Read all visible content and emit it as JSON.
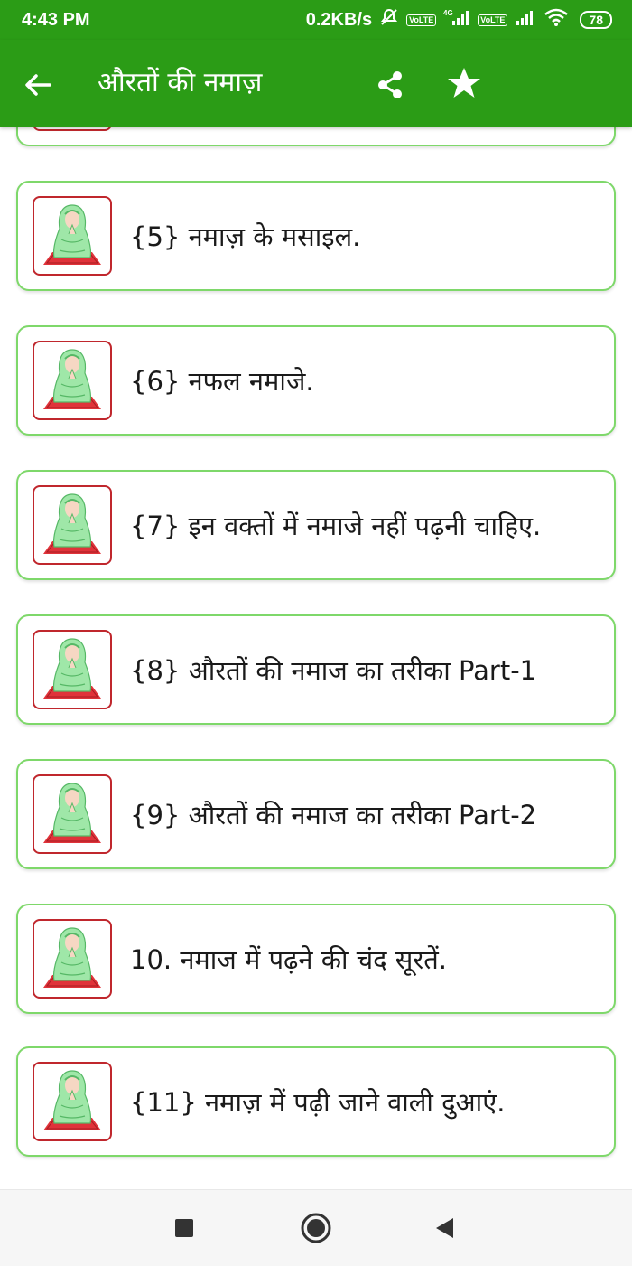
{
  "status_bar": {
    "time": "4:43 PM",
    "net_speed": "0.2KB/s",
    "volte_1": "Vo\nLTE",
    "network_4g": "4G",
    "volte_2": "Vo\nLTE",
    "battery": "78"
  },
  "app_bar": {
    "title": "औरतों की नमाज़",
    "icons": [
      "back-arrow-icon",
      "share-icon",
      "star-icon"
    ]
  },
  "list": {
    "items": [
      {
        "label": ""
      },
      {
        "label": "{5} नमाज़ के मसाइल."
      },
      {
        "label": "{6} नफल नमाजे."
      },
      {
        "label": "{7} इन वक्तों में नमाजे नहीं पढ़नी चाहिए."
      },
      {
        "label": "{8} औरतों की नमाज का तरीका Part-1"
      },
      {
        "label": "{9} औरतों की नमाज का तरीका Part-2"
      },
      {
        "label": "10. नमाज में पढ़ने की चंद सूरतें."
      },
      {
        "label": "{11} नमाज़ में पढ़ी जाने वाली दुआएं."
      }
    ]
  },
  "nav_bar": {
    "icons": [
      "recent-apps-icon",
      "home-icon",
      "back-icon"
    ]
  },
  "colors": {
    "primary_green": "#2b9c16",
    "card_border": "#7ed86a",
    "thumb_border": "#c0272d",
    "figure_green": "#9fe7a8",
    "prayer_mat": "#e0333a"
  }
}
